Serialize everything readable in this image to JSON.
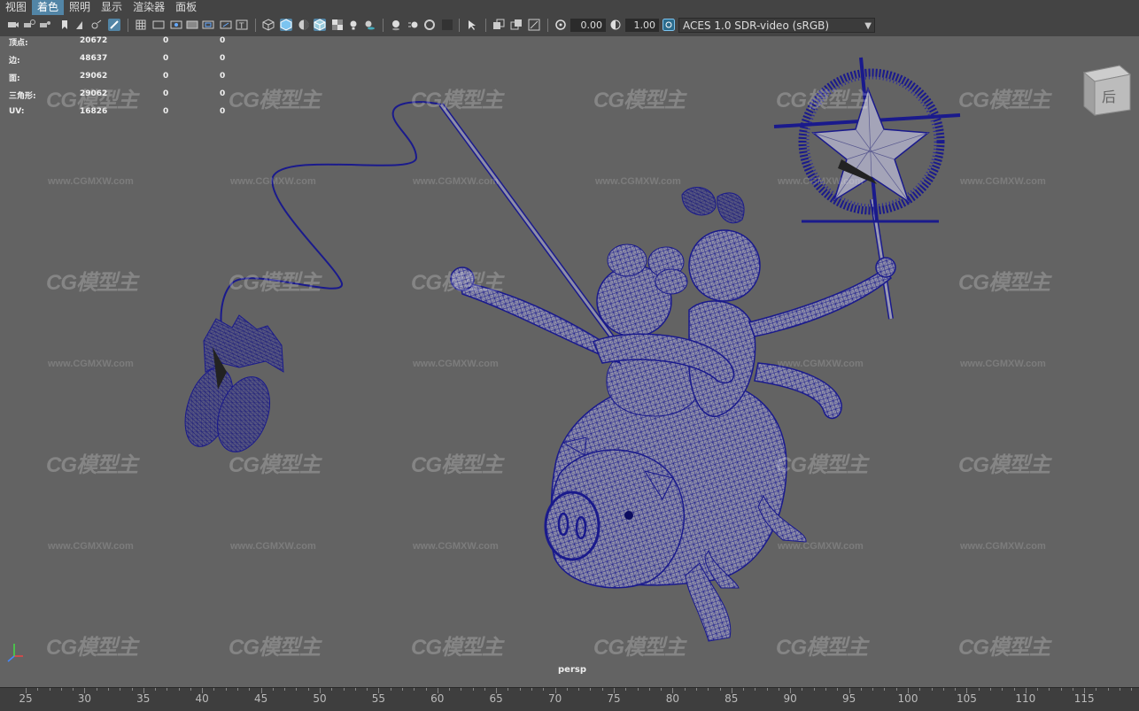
{
  "menu": [
    {
      "label": "视图",
      "active": false
    },
    {
      "label": "着色",
      "active": true
    },
    {
      "label": "照明",
      "active": false
    },
    {
      "label": "显示",
      "active": false
    },
    {
      "label": "渲染器",
      "active": false
    },
    {
      "label": "面板",
      "active": false
    }
  ],
  "toolbar": {
    "exposure": "0.00",
    "gamma": "1.00",
    "colorspace": "ACES 1.0 SDR-video (sRGB)"
  },
  "hud": {
    "rows": [
      {
        "label": "顶点:",
        "v1": "20672",
        "v2": "0",
        "v3": "0"
      },
      {
        "label": "边:",
        "v1": "48637",
        "v2": "0",
        "v3": "0"
      },
      {
        "label": "面:",
        "v1": "29062",
        "v2": "0",
        "v3": "0"
      },
      {
        "label": "三角形:",
        "v1": "29062",
        "v2": "0",
        "v3": "0"
      },
      {
        "label": "UV:",
        "v1": "16826",
        "v2": "0",
        "v3": "0"
      }
    ]
  },
  "viewcube": {
    "label": "后"
  },
  "camera_label": "persp",
  "watermark": {
    "logo": "CG模型主",
    "url": "www.CGMXW.com"
  },
  "timeline": {
    "ticks": [
      "25",
      "30",
      "35",
      "40",
      "45",
      "50",
      "55",
      "60",
      "65",
      "70",
      "75",
      "80",
      "85",
      "90",
      "95",
      "100",
      "105",
      "110",
      "115"
    ]
  },
  "colors": {
    "wire": "#1a1a8c",
    "viewport_bg": "#636363",
    "accent": "#5285a6"
  }
}
